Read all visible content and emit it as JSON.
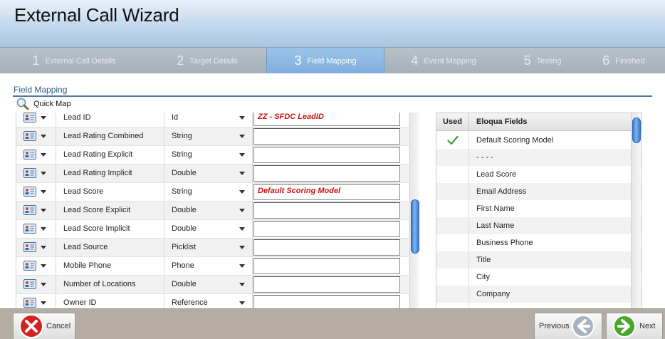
{
  "window": {
    "title": "External Call Wizard"
  },
  "steps": [
    {
      "num": "1",
      "label": "External Call Details",
      "active": false
    },
    {
      "num": "2",
      "label": "Target Details",
      "active": false
    },
    {
      "num": "3",
      "label": "Field Mapping",
      "active": true
    },
    {
      "num": "4",
      "label": "Event Mapping",
      "active": false
    },
    {
      "num": "5",
      "label": "Testing",
      "active": false
    },
    {
      "num": "6",
      "label": "Finished",
      "active": false
    }
  ],
  "section": {
    "title": "Field Mapping",
    "quick_map": "Quick Map"
  },
  "mapping_rows": [
    {
      "name": "Lead ID",
      "type": "Id",
      "value": "ZZ - SFDC LeadID"
    },
    {
      "name": "Lead Rating Combined",
      "type": "String",
      "value": ""
    },
    {
      "name": "Lead Rating Explicit",
      "type": "String",
      "value": ""
    },
    {
      "name": "Lead Rating Implicit",
      "type": "Double",
      "value": ""
    },
    {
      "name": "Lead Score",
      "type": "String",
      "value": "Default Scoring Model"
    },
    {
      "name": "Lead Score Explicit",
      "type": "Double",
      "value": ""
    },
    {
      "name": "Lead Score Implicit",
      "type": "Double",
      "value": ""
    },
    {
      "name": "Lead Source",
      "type": "Picklist",
      "value": ""
    },
    {
      "name": "Mobile Phone",
      "type": "Phone",
      "value": ""
    },
    {
      "name": "Number of Locations",
      "type": "Double",
      "value": ""
    },
    {
      "name": "Owner ID",
      "type": "Reference",
      "value": ""
    }
  ],
  "eloqua_panel": {
    "header_used": "Used",
    "header_fields": "Eloqua Fields",
    "fields": [
      {
        "name": "Default Scoring Model",
        "used": true
      },
      {
        "name": "- - - -",
        "used": false
      },
      {
        "name": "Lead Score",
        "used": false
      },
      {
        "name": "Email Address",
        "used": false
      },
      {
        "name": "First Name",
        "used": false
      },
      {
        "name": "Last Name",
        "used": false
      },
      {
        "name": "Business Phone",
        "used": false
      },
      {
        "name": "Title",
        "used": false
      },
      {
        "name": "City",
        "used": false
      },
      {
        "name": "Company",
        "used": false
      },
      {
        "name": "",
        "used": false
      }
    ]
  },
  "footer": {
    "cancel_label": "Cancel",
    "previous_label": "Previous",
    "next_label": "Next"
  },
  "colors": {
    "accent": "#7faedc",
    "mapped_value": "#cc1111",
    "check": "#3aa03a"
  }
}
